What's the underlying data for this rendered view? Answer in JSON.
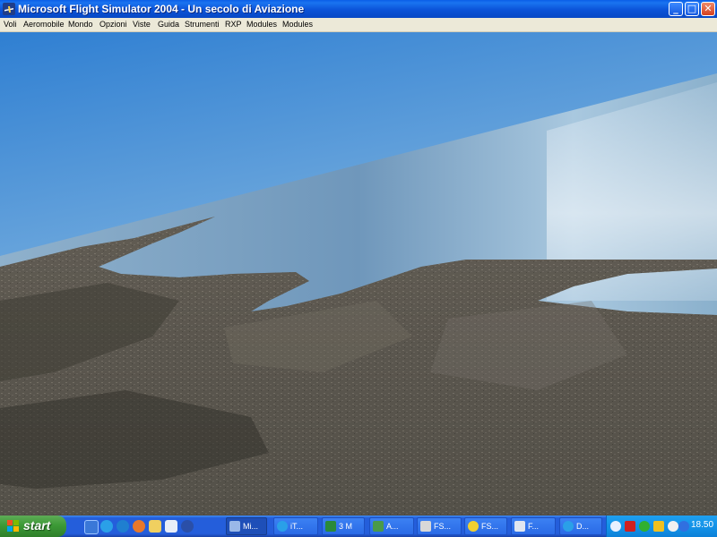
{
  "window": {
    "title": "Microsoft Flight Simulator 2004 - Un secolo di Aviazione",
    "minimize_glyph": "_",
    "maximize_glyph": "□",
    "close_glyph": "✕"
  },
  "menu": [
    "Voli",
    "Aeromobile",
    "Mondo",
    "Opzioni",
    "Viste",
    "Guida",
    "Strumenti",
    "RXP",
    "Modules",
    "Modules"
  ],
  "taskbar": {
    "start_label": "start",
    "quick_launch": [
      "desktop-icon",
      "internet-explorer-icon",
      "ie-icon",
      "firefox-icon",
      "windows-explorer-icon",
      "outlook-icon",
      "media-player-icon"
    ],
    "tasks": [
      {
        "label": "Mi...",
        "icon": "plane-icon",
        "active": true
      },
      {
        "label": "iT...",
        "icon": "browser-icon",
        "active": false
      },
      {
        "label": "3 M",
        "icon": "excel-icon",
        "active": false
      },
      {
        "label": "A...",
        "icon": "plane-icon",
        "active": false
      },
      {
        "label": "FS...",
        "icon": "fs-icon",
        "active": false
      },
      {
        "label": "FS...",
        "icon": "fs-icon",
        "active": false
      },
      {
        "label": "F...",
        "icon": "window-icon",
        "active": false
      },
      {
        "label": "D...",
        "icon": "browser-icon",
        "active": false
      }
    ],
    "clock": "18.50"
  },
  "colors": {
    "titlebar": "#0b53d8",
    "menubar": "#ece9d8",
    "taskbar": "#245edb",
    "start_green": "#3c9a36",
    "sky_top": "#3a86d4",
    "sea": "#7aa3c4",
    "land": "#5a5650"
  }
}
